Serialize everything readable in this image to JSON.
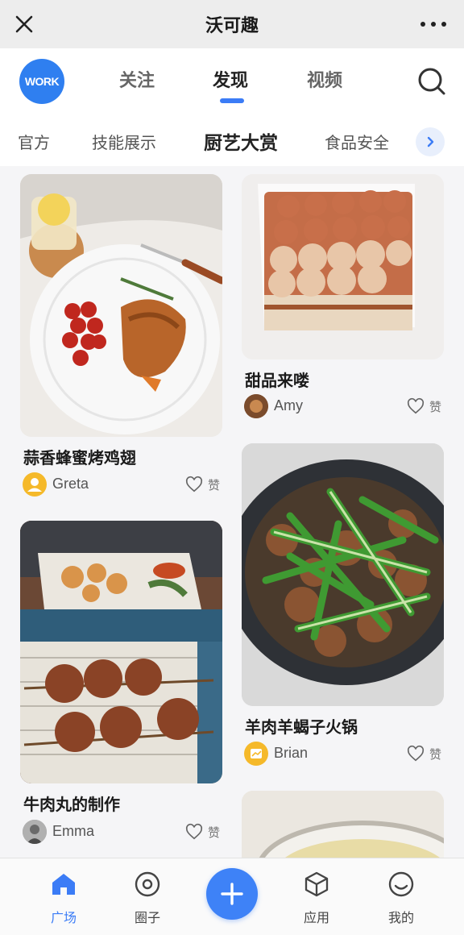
{
  "window": {
    "title": "沃可趣",
    "close_icon": "close-icon",
    "more_icon": "more-icon"
  },
  "topnav": {
    "logo_text": "WORK",
    "tabs": [
      {
        "label": "关注",
        "active": false
      },
      {
        "label": "发现",
        "active": true
      },
      {
        "label": "视频",
        "active": false
      }
    ],
    "search_icon": "search-icon"
  },
  "categories": {
    "items": [
      "官方",
      "技能展示",
      "厨艺大赏",
      "食品安全"
    ],
    "active": "厨艺大赏",
    "next_icon": "chevron-right-icon"
  },
  "feed": {
    "like_label": "赞",
    "cards": [
      {
        "title": "蒜香蜂蜜烤鸡翅",
        "author": "Greta"
      },
      {
        "title": "甜品来喽",
        "author": "Amy"
      },
      {
        "title": "牛肉丸的制作",
        "author": "Emma"
      },
      {
        "title": "羊肉羊蝎子火锅",
        "author": "Brian"
      }
    ]
  },
  "bottom_nav": {
    "items": [
      {
        "label": "广场",
        "icon": "home-icon",
        "active": true
      },
      {
        "label": "圈子",
        "icon": "circle-icon",
        "active": false
      },
      {
        "label": "",
        "icon": "plus-icon",
        "active": false
      },
      {
        "label": "应用",
        "icon": "cube-icon",
        "active": false
      },
      {
        "label": "我的",
        "icon": "smile-icon",
        "active": false
      }
    ]
  },
  "colors": {
    "accent": "#3b7cf6",
    "titlebar_bg": "#ededed",
    "text": "#222222"
  }
}
